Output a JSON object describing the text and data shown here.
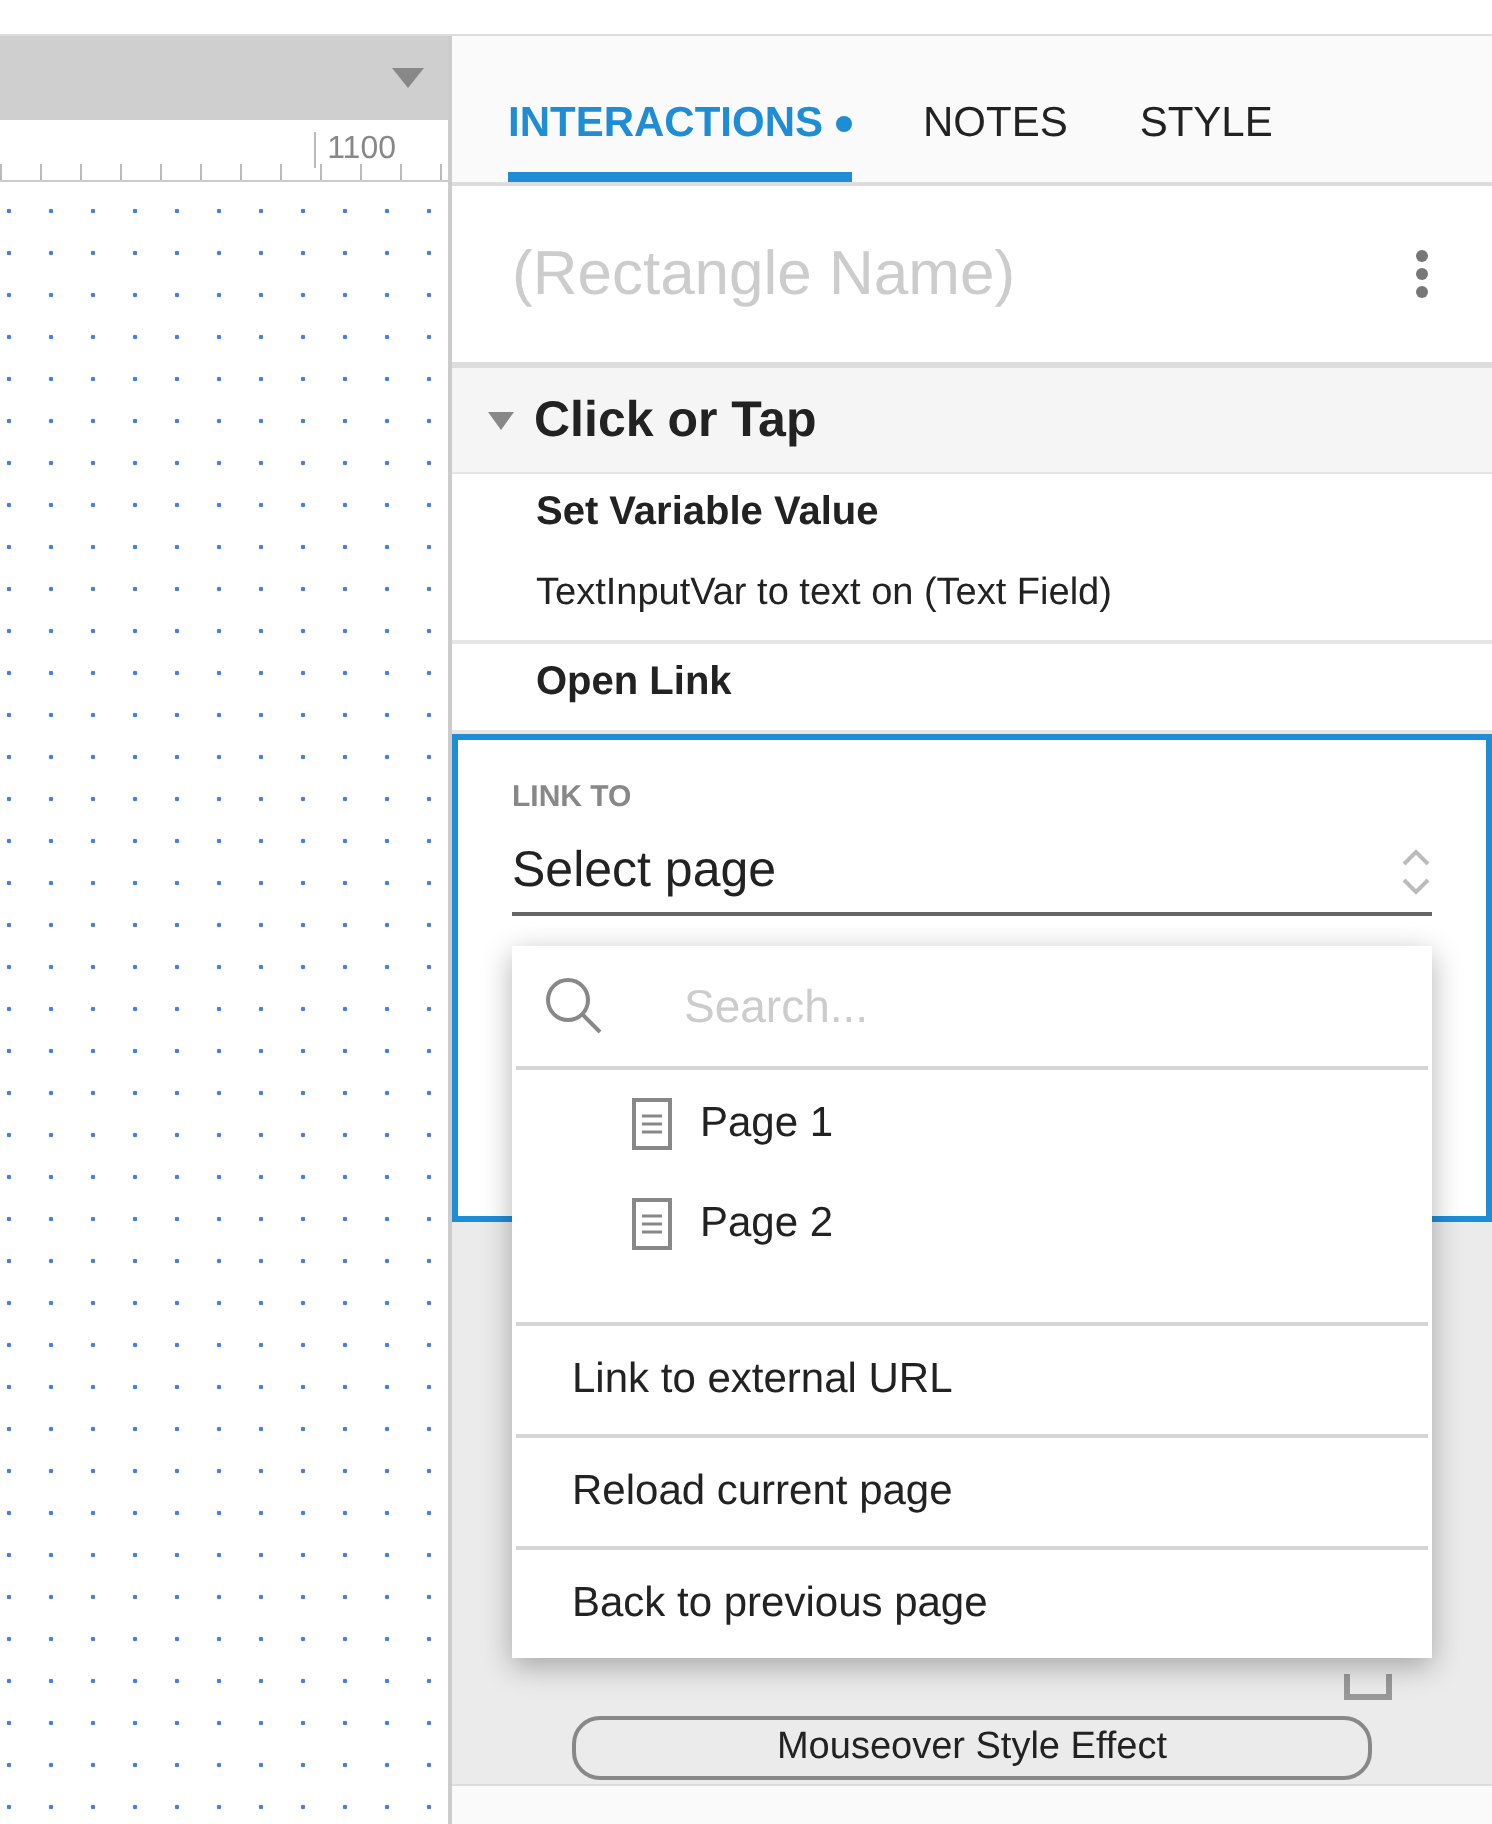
{
  "canvas": {
    "ruler_label": "1100"
  },
  "tabs": [
    {
      "label": "INTERACTIONS",
      "selected": true,
      "indicator": true
    },
    {
      "label": "NOTES",
      "selected": false,
      "indicator": false
    },
    {
      "label": "STYLE",
      "selected": false,
      "indicator": false
    }
  ],
  "element_name": {
    "placeholder": "(Rectangle Name)"
  },
  "event": {
    "title": "Click or Tap",
    "expanded": true
  },
  "actions": [
    {
      "title": "Set Variable Value",
      "detail": "TextInputVar to text on (Text Field)"
    },
    {
      "title": "Open Link"
    }
  ],
  "link_to": {
    "label": "LINK TO",
    "value": "Select page"
  },
  "dropdown": {
    "search_placeholder": "Search...",
    "pages": [
      "Page 1",
      "Page 2"
    ],
    "options": [
      "Link to external URL",
      "Reload current page",
      "Back to previous page"
    ]
  },
  "mouseover_button": "Mouseover Style Effect"
}
